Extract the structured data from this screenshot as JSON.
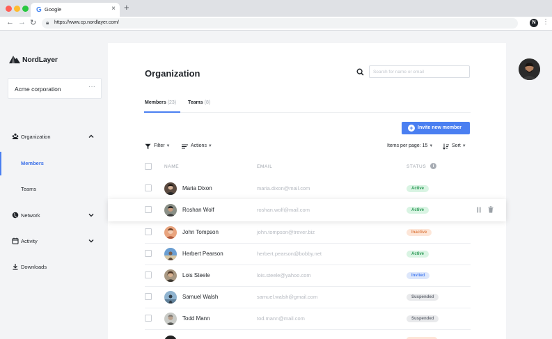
{
  "browser": {
    "tab_title": "Google",
    "url": "https://www.cp.nordlayer.com/",
    "extension_letter": "N"
  },
  "sidebar": {
    "brand": "NordLayer",
    "company": "Acme corporation",
    "company_more": "···",
    "items": [
      {
        "label": "Organization",
        "icon": "organization-icon",
        "expanded": true
      },
      {
        "label": "Members",
        "active": true
      },
      {
        "label": "Teams"
      },
      {
        "label": "Network",
        "icon": "globe-icon"
      },
      {
        "label": "Activity",
        "icon": "calendar-icon"
      },
      {
        "label": "Downloads",
        "icon": "download-icon"
      }
    ]
  },
  "main": {
    "title": "Organization",
    "search_placeholder": "Search for name or email",
    "tabs": [
      {
        "label": "Members",
        "count": "(23)",
        "active": true
      },
      {
        "label": "Teams",
        "count": "(8)"
      }
    ],
    "invite_label": "Invite new member",
    "toolbar": {
      "filter_label": "Filter",
      "actions_label": "Actions",
      "items_per_page_label": "Items per page: 15",
      "sort_label": "Sort"
    },
    "table": {
      "columns": [
        "NAME",
        "EMAIL",
        "STATUS"
      ],
      "rows": [
        {
          "name": "Maria Dixon",
          "email": "maria.dixon@mail.com",
          "status": "Active"
        },
        {
          "name": "Roshan Wolf",
          "email": "roshan.wolf@mail.com",
          "status": "Active"
        },
        {
          "name": "John Tompson",
          "email": "john.tompson@trever.biz",
          "status": "Inactive"
        },
        {
          "name": "Herbert Pearson",
          "email": "herbert.pearson@bobby.net",
          "status": "Active"
        },
        {
          "name": "Lois Steele",
          "email": "lois.steele@yahoo.com",
          "status": "Invited"
        },
        {
          "name": "Samuel Walsh",
          "email": "samuel.walsh@gmail.com",
          "status": "Suspended"
        },
        {
          "name": "Todd Mann",
          "email": "tod.mann@mail.com",
          "status": "Suspended"
        }
      ]
    }
  },
  "colors": {
    "accent": "#4a7ff1",
    "active": "#2e9a58",
    "inactive": "#e0844f",
    "suspended": "#6b7079"
  }
}
